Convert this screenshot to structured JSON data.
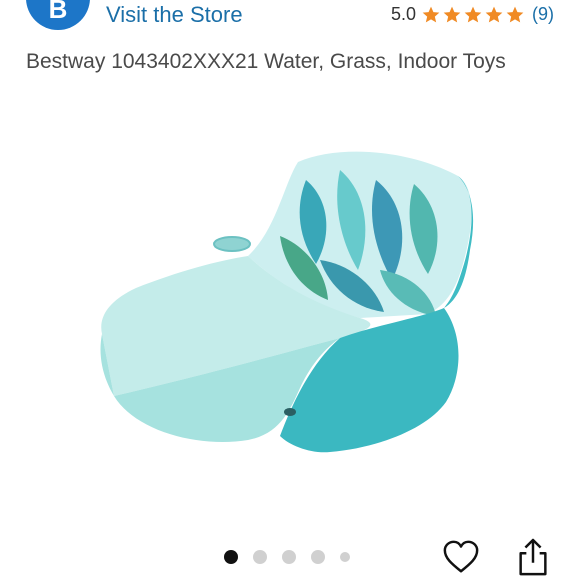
{
  "store": {
    "logo_letter": "B",
    "visit_label": "Visit the Store"
  },
  "rating": {
    "value": "5.0",
    "stars": 5,
    "count_label": "(9)",
    "star_color": "#f08a24"
  },
  "product": {
    "title": "Bestway 1043402XXX21 Water, Grass, Indoor Toys"
  },
  "carousel": {
    "total_dots": 5,
    "active_index": 0
  },
  "actions": {
    "heart_icon": "heart-icon",
    "share_icon": "share-icon"
  },
  "colors": {
    "link": "#1b6fa8",
    "brand_blue": "#1d76c8",
    "float_aqua": "#9fe1dd",
    "float_teal": "#38b9c0"
  }
}
